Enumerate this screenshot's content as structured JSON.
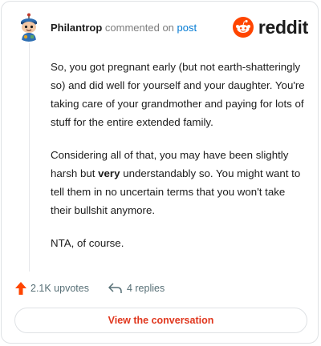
{
  "comment": {
    "username": "Philantrop",
    "action_text": "commented on",
    "post_link": "post",
    "paragraphs": {
      "p1": "So, you got pregnant early (but not earth-shatteringly so) and did well for yourself and your daughter. You're taking care of your grandmother and paying for lots of stuff for the entire extended family.",
      "p2_before": "Considering all of that, you may have been slightly harsh but ",
      "p2_bold": "very",
      "p2_after": " understandably so. You might want to tell them in no uncertain terms that you won't take their bullshit anymore.",
      "p3": "NTA, of course."
    }
  },
  "brand": {
    "logo_text": "reddit",
    "color": "#ff4500"
  },
  "actions": {
    "upvotes": "2.1K upvotes",
    "replies": "4 replies"
  },
  "view_button": {
    "label": "View the conversation"
  },
  "icons": {
    "avatar": "user-avatar",
    "logo": "reddit-snoo-icon",
    "upvote": "upvote-arrow-icon",
    "reply": "reply-arrow-icon"
  },
  "colors": {
    "accent": "#e0361d",
    "link": "#0079d3",
    "upvote": "#ff4500"
  }
}
